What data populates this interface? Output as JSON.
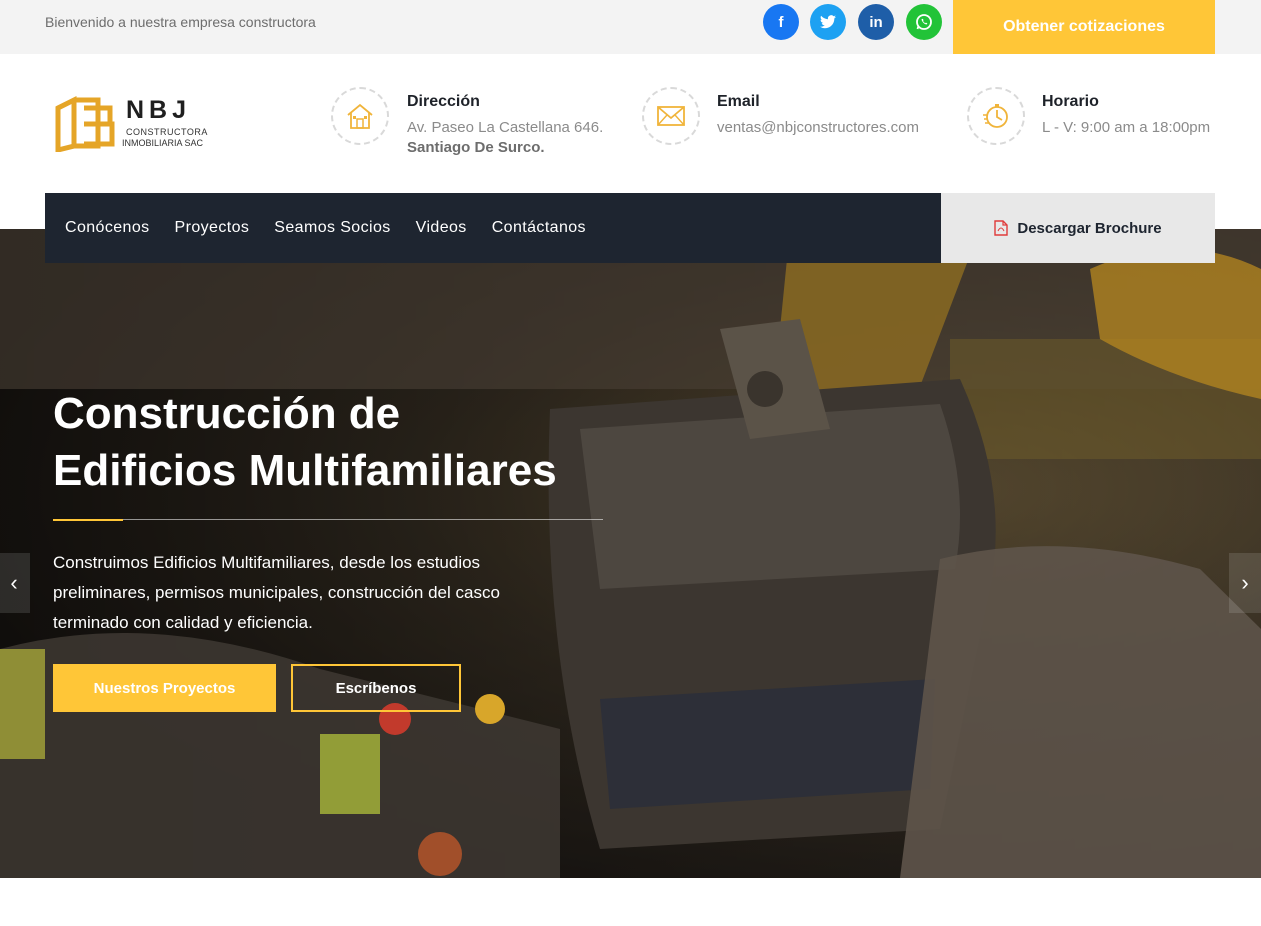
{
  "topbar": {
    "welcome": "Bienvenido a nuestra empresa constructora",
    "social": [
      {
        "icon": "facebook-icon",
        "glyph": "f"
      },
      {
        "icon": "twitter-icon",
        "glyph": "t"
      },
      {
        "icon": "linkedin-icon",
        "glyph": "in"
      },
      {
        "icon": "whatsapp-icon",
        "glyph": "w"
      }
    ],
    "quote_button": "Obtener cotizaciones"
  },
  "logo": {
    "name": "NBJ",
    "line1": "CONSTRUCTORA",
    "line2": "INMOBILIARIA SAC"
  },
  "info": {
    "address": {
      "title": "Dirección",
      "line1": "Av. Paseo La Castellana 646.",
      "line2": "Santiago De Surco.",
      "icon": "house-icon"
    },
    "email": {
      "title": "Email",
      "line1": "ventas@nbjconstructores.com",
      "icon": "envelope-icon"
    },
    "hours": {
      "title": "Horario",
      "line1": "L - V: 9:00 am a 18:00pm",
      "icon": "clock-icon"
    }
  },
  "nav": {
    "items": [
      "Conócenos",
      "Proyectos",
      "Seamos Socios",
      "Videos",
      "Contáctanos"
    ],
    "brochure": "Descargar Brochure"
  },
  "hero": {
    "title_line1": "Construcción de",
    "title_line2": "Edificios Multifamiliares",
    "text": "Construimos Edificios Multifamiliares, desde los estudios preliminares, permisos municipales, construcción del casco terminado con calidad y eficiencia.",
    "primary_button": "Nuestros Proyectos",
    "secondary_button": "Escríbenos"
  },
  "colors": {
    "accent": "#ffc637",
    "nav_bg": "#1e2530"
  }
}
